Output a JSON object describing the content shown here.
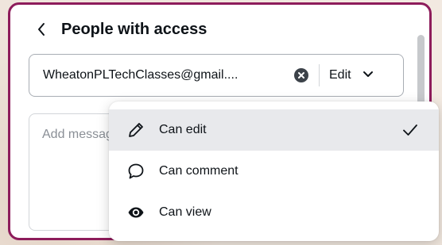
{
  "panel": {
    "title": "People with access"
  },
  "share_row": {
    "email_value": "WheatonPLTechClasses@gmail....",
    "role_label": "Edit"
  },
  "message": {
    "placeholder": "Add message"
  },
  "role_menu": {
    "items": [
      {
        "label": "Can edit",
        "icon": "pencil-icon",
        "selected": true
      },
      {
        "label": "Can comment",
        "icon": "speech-bubble-icon",
        "selected": false
      },
      {
        "label": "Can view",
        "icon": "eye-icon",
        "selected": false
      }
    ]
  },
  "colors": {
    "panel_border": "#8d1c5b",
    "selected_row": "#e8e9ec",
    "text": "#0e1318"
  }
}
